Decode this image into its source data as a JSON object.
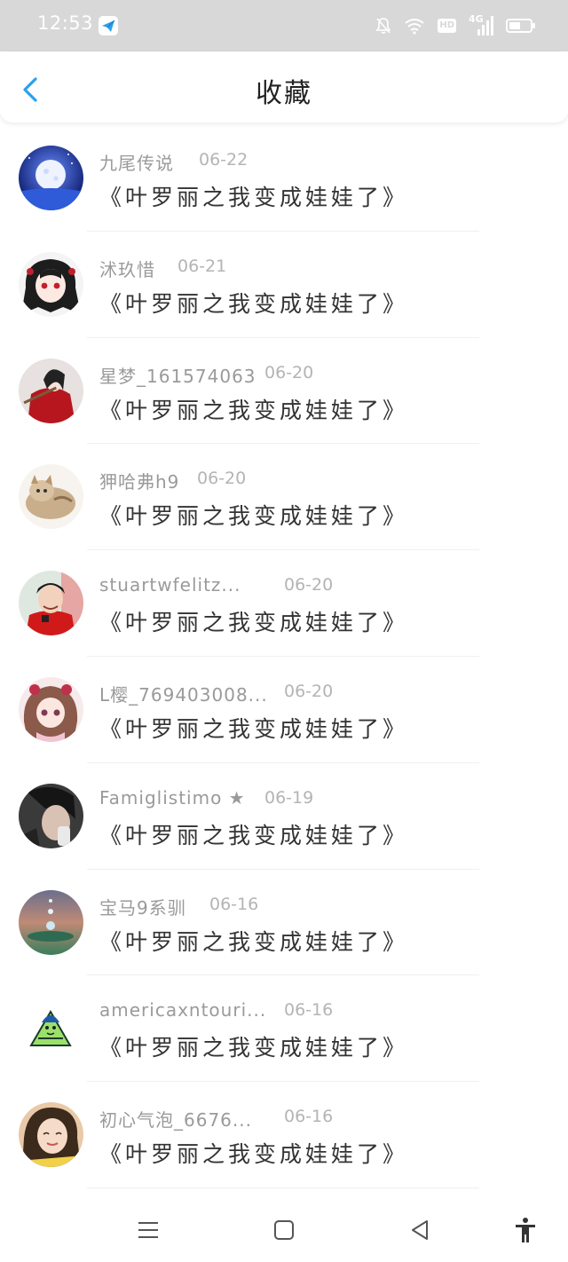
{
  "status_bar": {
    "time": "12:53",
    "network_label": "4G",
    "hd_label": "HD",
    "battery_level": 0.55,
    "icons": [
      "telegram-icon",
      "mute-icon",
      "wifi-icon",
      "hd-icon",
      "signal-icon",
      "battery-icon"
    ]
  },
  "header": {
    "title": "收藏",
    "back_icon": "chevron-left-icon",
    "accent_color": "#2ba0ee"
  },
  "items": [
    {
      "name": "九尾传说",
      "date": "06-22",
      "content": "《叶罗丽之我变成娃娃了》"
    },
    {
      "name": "沭玖惜",
      "date": "06-21",
      "content": "《叶罗丽之我变成娃娃了》"
    },
    {
      "name": "星梦_161574063",
      "date": "06-20",
      "content": "《叶罗丽之我变成娃娃了》"
    },
    {
      "name": "狎哈弗h9",
      "date": "06-20",
      "content": "《叶罗丽之我变成娃娃了》"
    },
    {
      "name": "stuartwfelitz...",
      "date": "06-20",
      "content": "《叶罗丽之我变成娃娃了》"
    },
    {
      "name": "L樱_769403008...",
      "date": "06-20",
      "content": "《叶罗丽之我变成娃娃了》"
    },
    {
      "name": "Famiglistimo ★",
      "date": "06-19",
      "content": "《叶罗丽之我变成娃娃了》"
    },
    {
      "name": "宝马9系驯",
      "date": "06-16",
      "content": "《叶罗丽之我变成娃娃了》"
    },
    {
      "name": "americaxntouri...",
      "date": "06-16",
      "content": "《叶罗丽之我变成娃娃了》"
    },
    {
      "name": "初心气泡_6676...",
      "date": "06-16",
      "content": "《叶罗丽之我变成娃娃了》"
    }
  ],
  "bottom_nav": [
    "menu-icon",
    "home-icon",
    "back-icon",
    "accessibility-icon"
  ]
}
